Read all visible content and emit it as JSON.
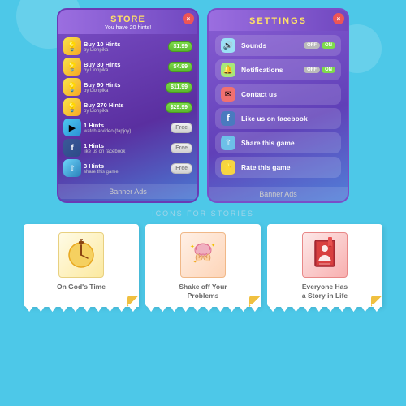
{
  "background": "#4dc8e8",
  "decorative": {
    "circles": 3
  },
  "store": {
    "title": "STORE",
    "subtitle": "You have 20 hints!",
    "close_label": "×",
    "items": [
      {
        "icon": "💡",
        "icon_type": "yellow",
        "name": "Buy 10 Hints",
        "sub": "by Lionpika",
        "price": "$1.99",
        "type": "price"
      },
      {
        "icon": "💡",
        "icon_type": "yellow",
        "name": "Buy 30 Hints",
        "sub": "by Lionpika",
        "price": "$4.99",
        "type": "price"
      },
      {
        "icon": "💡",
        "icon_type": "yellow",
        "name": "Buy 90 Hints",
        "sub": "by Lionpika",
        "price": "$11.99",
        "type": "price"
      },
      {
        "icon": "💡",
        "icon_type": "yellow",
        "name": "Buy 270 Hints",
        "sub": "by Lionpika",
        "price": "$29.99",
        "type": "price"
      },
      {
        "icon": "🔔",
        "icon_type": "blue",
        "name": "1 Hints",
        "sub": "watch a video (tapjoy)",
        "price": "Free",
        "type": "free"
      },
      {
        "icon": "f",
        "icon_type": "fb",
        "name": "1 Hints",
        "sub": "like us on facebook",
        "price": "Free",
        "type": "free"
      },
      {
        "icon": "◀",
        "icon_type": "share",
        "name": "3 Hints",
        "sub": "share this game",
        "price": "Free",
        "type": "free"
      }
    ],
    "banner_label": "Banner Ads"
  },
  "settings": {
    "title": "SETTINGS",
    "close_label": "×",
    "items": [
      {
        "icon": "🔊",
        "icon_type": "sound",
        "label": "Sounds",
        "toggle": true,
        "toggle_off": "OFF",
        "toggle_on": "ON"
      },
      {
        "icon": "🔔",
        "icon_type": "notif",
        "label": "Notifications",
        "toggle": true,
        "toggle_off": "OFF",
        "toggle_on": "ON"
      },
      {
        "icon": "✉",
        "icon_type": "contact",
        "label": "Contact us",
        "toggle": false
      },
      {
        "icon": "f",
        "icon_type": "fb",
        "label": "Like us on facebook",
        "toggle": false
      },
      {
        "icon": "◀",
        "icon_type": "share",
        "label": "Share this game",
        "toggle": false
      },
      {
        "icon": "⭐",
        "icon_type": "rate",
        "label": "Rate this game",
        "toggle": false
      }
    ],
    "banner_label": "Banner Ads"
  },
  "stories_section": {
    "section_title": "ICONS FOR STORIES",
    "cards": [
      {
        "emoji": "⛪",
        "image_type": "god",
        "label": "On God's Time"
      },
      {
        "emoji": "🧠",
        "image_type": "shake",
        "label": "Shake off Your\nProblems"
      },
      {
        "emoji": "📖",
        "image_type": "everyone",
        "label": "Everyone Has\na Story in Life"
      }
    ]
  }
}
